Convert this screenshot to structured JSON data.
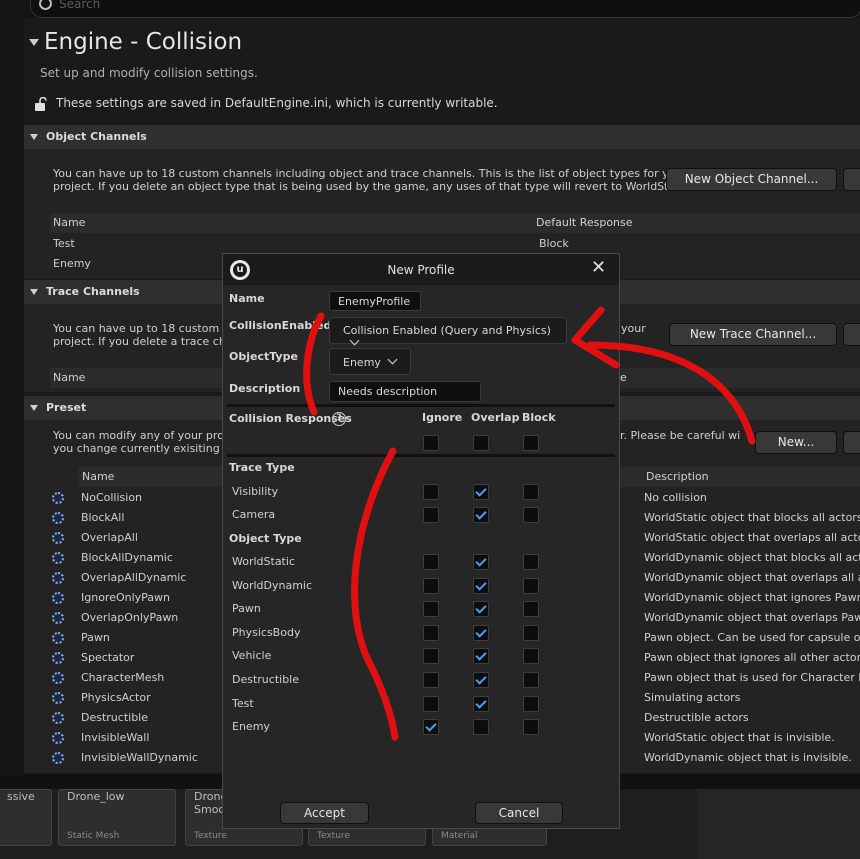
{
  "search": {
    "placeholder": "Search"
  },
  "page": {
    "title": "Engine - Collision",
    "subtitle": "Set up and modify collision settings.",
    "lock_note": "These settings are saved in DefaultEngine.ini, which is currently writable."
  },
  "object_channels": {
    "header": "Object Channels",
    "desc_line1": "You can have up to 18 custom channels including object and trace channels. This is the list of object types for your",
    "desc_line2": "project. If you delete an object type that is being used by the game, any uses of that type will revert to WorldStatic.",
    "new_button": "New Object Channel...",
    "col_name": "Name",
    "col_response": "Default Response",
    "rows": [
      {
        "name": "Test",
        "response": "Block"
      },
      {
        "name": "Enemy",
        "response": ""
      }
    ]
  },
  "trace_channels": {
    "header": "Trace Channels",
    "desc_line1": "You can have up to 18 custom cha",
    "desc_line1_right": "your",
    "desc_line2": "project. If you delete a trace chan",
    "new_button": "New Trace Channel...",
    "col_name": "Name",
    "col_right": "e"
  },
  "preset": {
    "header": "Preset",
    "desc_line1": "You can modify any of your project",
    "desc_line1_right": "r. Please be careful wi",
    "desc_line2": "you change currently exisiting (us",
    "new_button": "New...",
    "col_name": "Name",
    "col_desc": "Description",
    "rows": [
      {
        "name": "NoCollision",
        "desc": "No collision"
      },
      {
        "name": "BlockAll",
        "desc": "WorldStatic object that blocks all actors by"
      },
      {
        "name": "OverlapAll",
        "desc": "WorldStatic object that overlaps all actors t"
      },
      {
        "name": "BlockAllDynamic",
        "desc": "WorldDynamic object that blocks all actors"
      },
      {
        "name": "OverlapAllDynamic",
        "desc": "WorldDynamic object that overlaps all acto"
      },
      {
        "name": "IgnoreOnlyPawn",
        "desc": "WorldDynamic object that ignores Pawn and"
      },
      {
        "name": "OverlapOnlyPawn",
        "desc": "WorldDynamic object that overlaps Pawn, C"
      },
      {
        "name": "Pawn",
        "desc": "Pawn object. Can be used for capsule of an"
      },
      {
        "name": "Spectator",
        "desc": "Pawn object that ignores all other actors ex"
      },
      {
        "name": "CharacterMesh",
        "desc": "Pawn object that is used for Character Mes"
      },
      {
        "name": "PhysicsActor",
        "desc": "Simulating actors"
      },
      {
        "name": "Destructible",
        "desc": "Destructible actors"
      },
      {
        "name": "InvisibleWall",
        "desc": "WorldStatic object that is invisible."
      },
      {
        "name": "InvisibleWallDynamic",
        "desc": "WorldDynamic object that is invisible."
      }
    ]
  },
  "dialog": {
    "title": "New Profile",
    "name_label": "Name",
    "name_value": "EnemyProfile",
    "collision_enabled_label": "CollisionEnabled",
    "collision_enabled_value": "Collision Enabled (Query and Physics)",
    "object_type_label": "ObjectType",
    "object_type_value": "Enemy",
    "description_label": "Description",
    "description_value": "Needs description",
    "collision_responses_label": "Collision Responses",
    "col_ignore": "Ignore",
    "col_overlap": "Overlap",
    "col_block": "Block",
    "trace_type_label": "Trace Type",
    "object_type_section_label": "Object Type",
    "trace_rows": [
      {
        "name": "Visibility",
        "response": "overlap"
      },
      {
        "name": "Camera",
        "response": "overlap"
      }
    ],
    "object_rows": [
      {
        "name": "WorldStatic",
        "response": "overlap"
      },
      {
        "name": "WorldDynamic",
        "response": "overlap"
      },
      {
        "name": "Pawn",
        "response": "overlap"
      },
      {
        "name": "PhysicsBody",
        "response": "overlap"
      },
      {
        "name": "Vehicle",
        "response": "overlap"
      },
      {
        "name": "Destructible",
        "response": "overlap"
      },
      {
        "name": "Test",
        "response": "overlap"
      },
      {
        "name": "Enemy",
        "response": "ignore"
      }
    ],
    "accept_button": "Accept",
    "cancel_button": "Cancel"
  },
  "content_browser": {
    "items": [
      {
        "name": "ssive",
        "type": ""
      },
      {
        "name": "Drone_low",
        "type": "Static Mesh"
      },
      {
        "name": "Drone\nSmoo",
        "type": "Texture"
      },
      {
        "name": "",
        "type": "Texture"
      },
      {
        "name": "",
        "type": "Material"
      }
    ]
  },
  "colors": {
    "accent_check": "#4e9cf6",
    "annotation_red": "#e01010",
    "background": "#151515"
  }
}
